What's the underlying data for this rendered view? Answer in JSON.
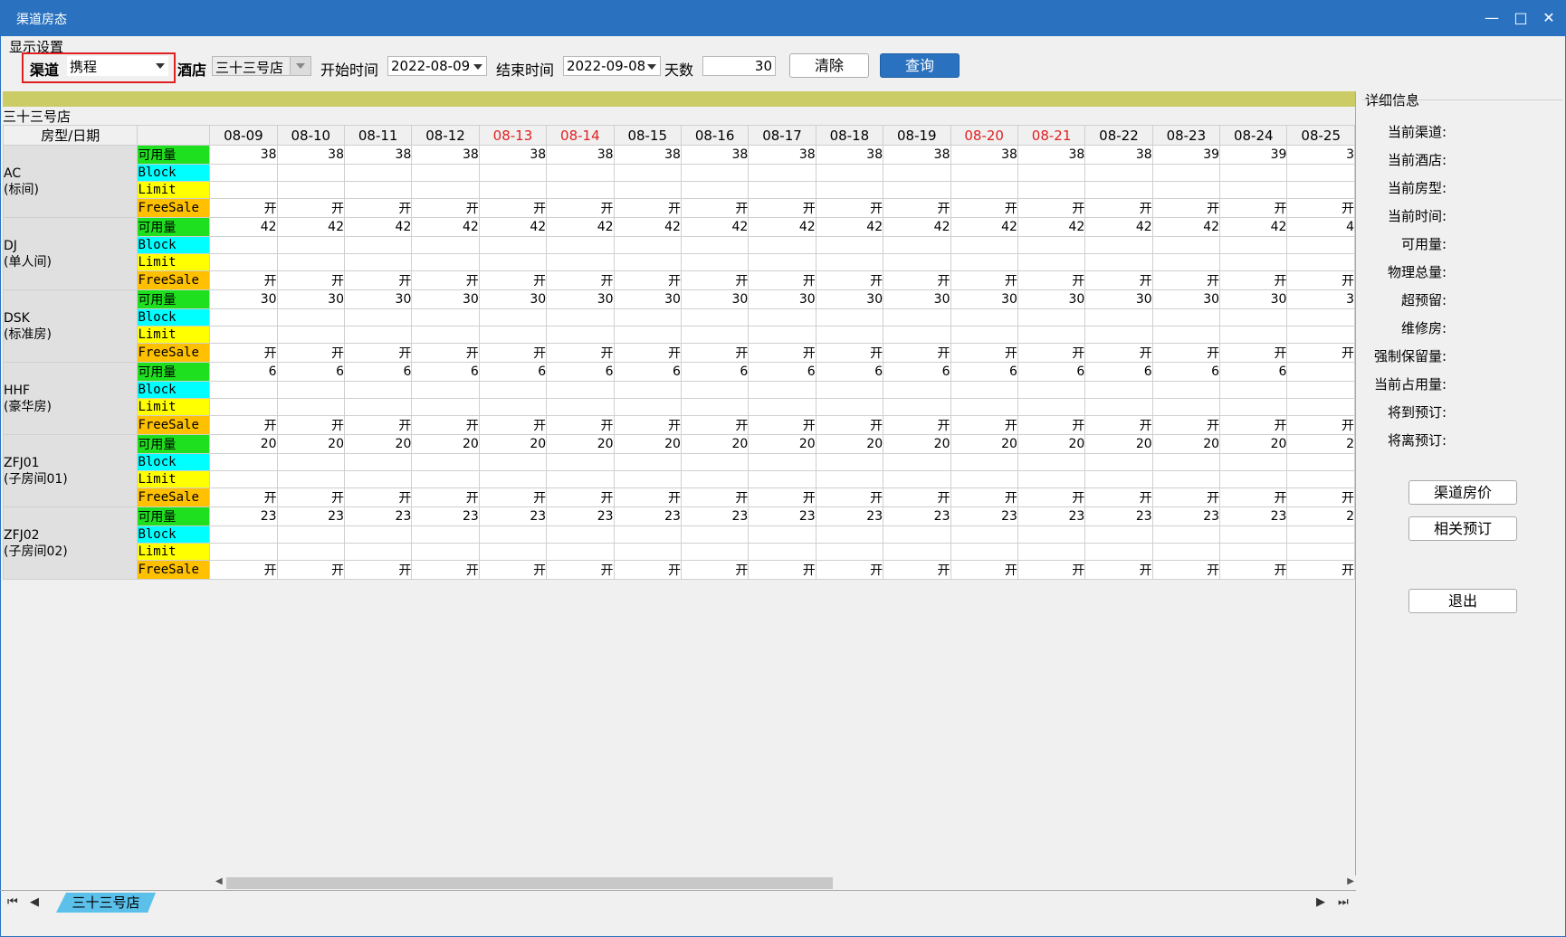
{
  "window": {
    "title": "渠道房态"
  },
  "settings": {
    "section_label": "显示设置",
    "channel_label": "渠道",
    "channel_value": "携程",
    "hotel_label": "酒店",
    "hotel_value": "三十三号店",
    "start_label": "开始时间",
    "start_value": "2022-08-09",
    "end_label": "结束时间",
    "end_value": "2022-09-08",
    "days_label": "天数",
    "days_value": "30",
    "clear_label": "清除",
    "query_label": "查询"
  },
  "grid": {
    "hotel_name": "三十三号店",
    "corner_label": "房型/日期",
    "dates": [
      {
        "label": "08-09",
        "weekend": false
      },
      {
        "label": "08-10",
        "weekend": false
      },
      {
        "label": "08-11",
        "weekend": false
      },
      {
        "label": "08-12",
        "weekend": false
      },
      {
        "label": "08-13",
        "weekend": true
      },
      {
        "label": "08-14",
        "weekend": true
      },
      {
        "label": "08-15",
        "weekend": false
      },
      {
        "label": "08-16",
        "weekend": false
      },
      {
        "label": "08-17",
        "weekend": false
      },
      {
        "label": "08-18",
        "weekend": false
      },
      {
        "label": "08-19",
        "weekend": false
      },
      {
        "label": "08-20",
        "weekend": true
      },
      {
        "label": "08-21",
        "weekend": true
      },
      {
        "label": "08-22",
        "weekend": false
      },
      {
        "label": "08-23",
        "weekend": false
      },
      {
        "label": "08-24",
        "weekend": false
      },
      {
        "label": "08-25",
        "weekend": false
      }
    ],
    "metrics": [
      "可用量",
      "Block",
      "Limit",
      "FreeSale"
    ],
    "room_types": [
      {
        "code": "AC",
        "name": "(标间)",
        "available": [
          "38",
          "38",
          "38",
          "38",
          "38",
          "38",
          "38",
          "38",
          "38",
          "38",
          "38",
          "38",
          "38",
          "38",
          "39",
          "39",
          "3"
        ],
        "freesale": "开"
      },
      {
        "code": "DJ",
        "name": "(单人间)",
        "available": [
          "42",
          "42",
          "42",
          "42",
          "42",
          "42",
          "42",
          "42",
          "42",
          "42",
          "42",
          "42",
          "42",
          "42",
          "42",
          "42",
          "4"
        ],
        "freesale": "开"
      },
      {
        "code": "DSK",
        "name": "(标准房)",
        "available": [
          "30",
          "30",
          "30",
          "30",
          "30",
          "30",
          "30",
          "30",
          "30",
          "30",
          "30",
          "30",
          "30",
          "30",
          "30",
          "30",
          "3"
        ],
        "freesale": "开"
      },
      {
        "code": "HHF",
        "name": "(豪华房)",
        "available": [
          "6",
          "6",
          "6",
          "6",
          "6",
          "6",
          "6",
          "6",
          "6",
          "6",
          "6",
          "6",
          "6",
          "6",
          "6",
          "6",
          ""
        ],
        "freesale": "开"
      },
      {
        "code": "ZFJ01",
        "name": "(子房间01)",
        "available": [
          "20",
          "20",
          "20",
          "20",
          "20",
          "20",
          "20",
          "20",
          "20",
          "20",
          "20",
          "20",
          "20",
          "20",
          "20",
          "20",
          "2"
        ],
        "freesale": "开"
      },
      {
        "code": "ZFJ02",
        "name": "(子房间02)",
        "available": [
          "23",
          "23",
          "23",
          "23",
          "23",
          "23",
          "23",
          "23",
          "23",
          "23",
          "23",
          "23",
          "23",
          "23",
          "23",
          "23",
          "2"
        ],
        "freesale": "开"
      }
    ],
    "colors": {
      "available": "#1fe01f",
      "block": "#00ffff",
      "limit": "#ffff00",
      "freesale": "#ffc000",
      "weekend": "#e02020",
      "band": "#cccc66"
    }
  },
  "sheet_tab": {
    "label": "三十三号店"
  },
  "detail": {
    "title": "详细信息",
    "labels": [
      "当前渠道:",
      "当前酒店:",
      "当前房型:",
      "当前时间:",
      "可用量:",
      "物理总量:",
      "超预留:",
      "维修房:",
      "强制保留量:",
      "当前占用量:",
      "将到预订:",
      "将离预订:"
    ],
    "buttons": {
      "channel_rate": "渠道房价",
      "related_booking": "相关预订",
      "exit": "退出"
    }
  }
}
